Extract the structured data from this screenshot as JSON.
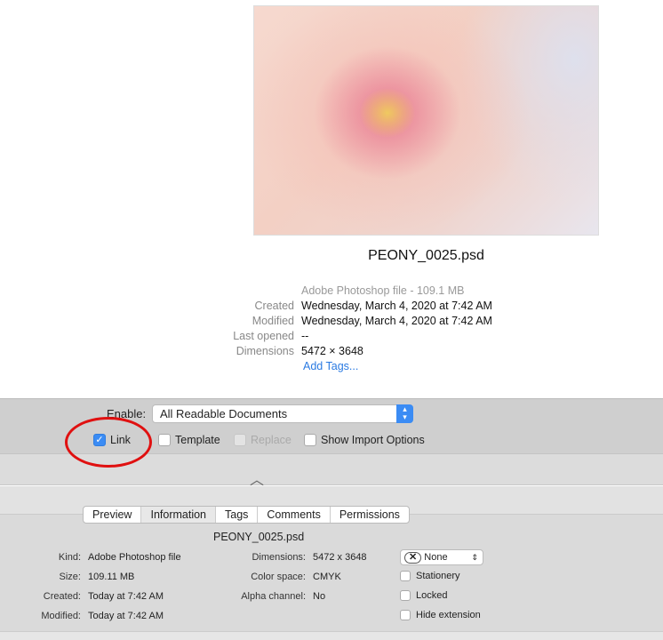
{
  "preview": {
    "filename": "PEONY_0025.psd",
    "kind_line": "Adobe Photoshop file - 109.1 MB",
    "rows": [
      {
        "label": "Created",
        "value": "Wednesday, March 4, 2020 at 7:42 AM"
      },
      {
        "label": "Modified",
        "value": "Wednesday, March 4, 2020 at 7:42 AM"
      },
      {
        "label": "Last opened",
        "value": "--"
      },
      {
        "label": "Dimensions",
        "value": "5472 × 3648"
      }
    ],
    "add_tags": "Add Tags..."
  },
  "options": {
    "enable_label": "Enable:",
    "enable_value": "All Readable Documents",
    "checkboxes": [
      {
        "label": "Link",
        "checked": true
      },
      {
        "label": "Template",
        "checked": false
      },
      {
        "label": "Replace",
        "checked": false,
        "disabled": true
      },
      {
        "label": "Show Import Options",
        "checked": false
      }
    ]
  },
  "tabs": [
    "Preview",
    "Information",
    "Tags",
    "Comments",
    "Permissions"
  ],
  "selected_tab": "Information",
  "info": {
    "filename": "PEONY_0025.psd",
    "col1": [
      {
        "label": "Kind:",
        "value": "Adobe Photoshop file"
      },
      {
        "label": "Size:",
        "value": "109.11 MB"
      },
      {
        "label": "Created:",
        "value": "Today at 7:42 AM"
      },
      {
        "label": "Modified:",
        "value": "Today at 7:42 AM"
      }
    ],
    "col2": [
      {
        "label": "Dimensions:",
        "value": "5472 x 3648"
      },
      {
        "label": "Color space:",
        "value": "CMYK"
      },
      {
        "label": "Alpha channel:",
        "value": "No"
      }
    ],
    "label_select": "None",
    "checkboxes": [
      "Stationery",
      "Locked",
      "Hide extension"
    ]
  },
  "colors": {
    "accent": "#3b8cf4",
    "annotation": "#e01010"
  }
}
